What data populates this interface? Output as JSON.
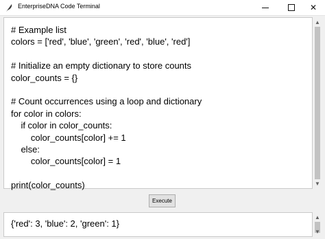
{
  "window": {
    "title": "EnterpriseDNA Code Terminal",
    "icon": "feather-icon",
    "controls": [
      "minimize-icon",
      "maximize-icon",
      "close-icon"
    ],
    "close_glyph": "✕"
  },
  "editor": {
    "lines": [
      "# Example list",
      "colors = ['red', 'blue', 'green', 'red', 'blue', 'red']",
      "",
      "# Initialize an empty dictionary to store counts",
      "color_counts = {}",
      "",
      "# Count occurrences using a loop and dictionary",
      "for color in colors:",
      "    if color in color_counts:",
      "        color_counts[color] += 1",
      "    else:",
      "        color_counts[color] = 1",
      "",
      "print(color_counts)"
    ]
  },
  "execute_button": {
    "label": "Execute"
  },
  "output": {
    "text": "{'red': 3, 'blue': 2, 'green': 1}"
  },
  "colors": {
    "window_bg": "#f0f0f0",
    "text_bg": "#ffffff",
    "button_bg": "#e1e1e1",
    "scroll_thumb": "#c2c2c2"
  }
}
